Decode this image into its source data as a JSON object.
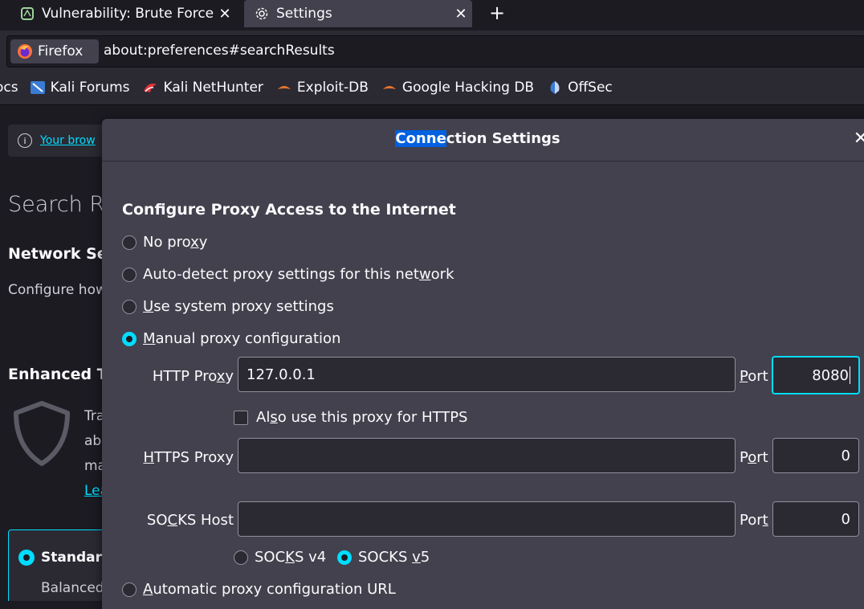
{
  "tabs": [
    {
      "title": "Vulnerability: Brute Force",
      "icon": "dvwa-icon"
    },
    {
      "title": "Settings",
      "icon": "gear-icon"
    }
  ],
  "urlbar": {
    "identity": "Firefox",
    "url": "about:preferences#searchResults"
  },
  "bookmarks": [
    {
      "label": "ocs",
      "icon": ""
    },
    {
      "label": "Kali Forums",
      "icon": "kali-forums-icon"
    },
    {
      "label": "Kali NetHunter",
      "icon": "kali-nethunter-icon"
    },
    {
      "label": "Exploit-DB",
      "icon": "exploit-db-icon"
    },
    {
      "label": "Google Hacking DB",
      "icon": "ghdb-icon"
    },
    {
      "label": "OffSec",
      "icon": "offsec-icon"
    }
  ],
  "page": {
    "notice_link": "Your brow",
    "search_results": "Search Re",
    "network_heading": "Network Se",
    "network_desc": "Configure how",
    "etp_heading": "Enhanced T",
    "etp_lines": [
      "Tra",
      "ab",
      "ma"
    ],
    "etp_link": "Lea",
    "standard_label": "Standard",
    "standard_sub": "Balanced"
  },
  "dialog": {
    "title_highlight": "Conne",
    "title_rest": "ction Settings",
    "section_title": "Configure Proxy Access to the Internet",
    "options": {
      "no_proxy": {
        "pre": "No pro",
        "acc": "x",
        "post": "y"
      },
      "auto_detect": {
        "pre": "Auto-detect proxy settings for this net",
        "acc": "w",
        "post": "ork"
      },
      "system": {
        "pre": "",
        "acc": "U",
        "post": "se system proxy settings"
      },
      "manual": {
        "pre": "",
        "acc": "M",
        "post": "anual proxy configuration"
      },
      "auto_url": {
        "pre": "",
        "acc": "A",
        "post": "utomatic proxy configuration URL"
      }
    },
    "http": {
      "label_pre": "HTTP Pro",
      "label_acc": "x",
      "label_post": "y",
      "value": "127.0.0.1",
      "port_label_pre": "",
      "port_label_acc": "P",
      "port_label_post": "ort",
      "port": "8080"
    },
    "also_https": {
      "pre": "Al",
      "acc": "s",
      "post": "o use this proxy for HTTPS"
    },
    "https": {
      "label_pre": "",
      "label_acc": "H",
      "label_post": "TTPS Proxy",
      "value": "",
      "port_label_pre": "P",
      "port_label_acc": "o",
      "port_label_post": "rt",
      "port": "0"
    },
    "socks": {
      "label_pre": "SO",
      "label_acc": "C",
      "label_post": "KS Host",
      "value": "",
      "port_label_pre": "Por",
      "port_label_acc": "t",
      "port_label_post": "",
      "port": "0"
    },
    "socks_v4": {
      "pre": "SOC",
      "acc": "K",
      "post": "S v4"
    },
    "socks_v5": {
      "pre": "SOCKS ",
      "acc": "v",
      "post": "5"
    },
    "selected_option": "manual",
    "selected_socks": "v5"
  },
  "colors": {
    "accent": "#00ddff",
    "highlight": "#0060df",
    "dialog_bg": "#42414d",
    "page_bg": "#1c1b22"
  }
}
